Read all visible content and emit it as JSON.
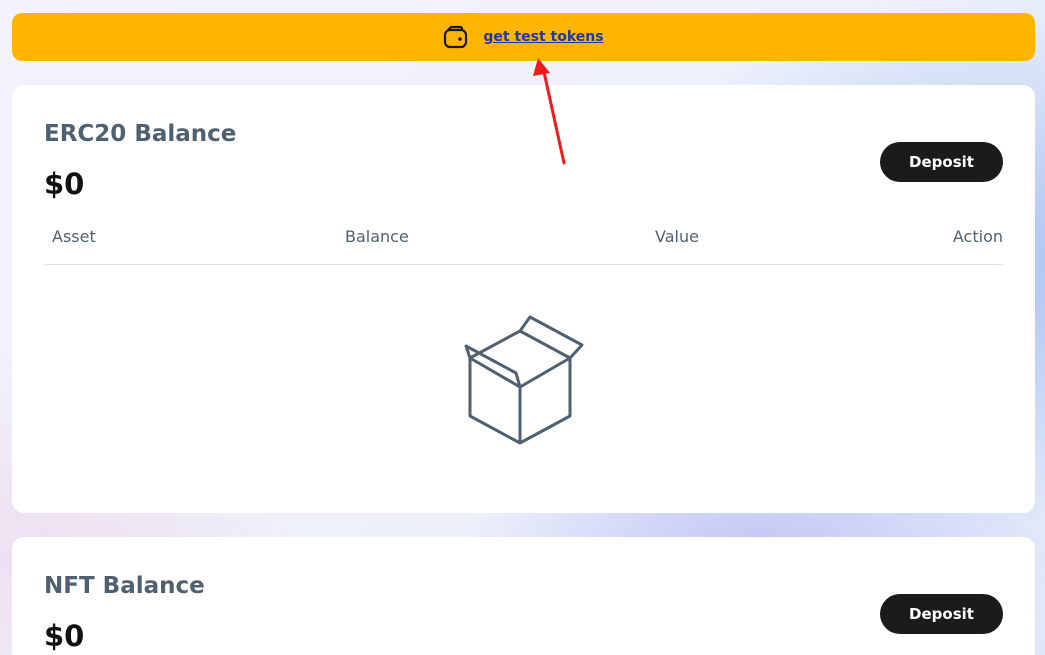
{
  "banner": {
    "link_text": "get test tokens",
    "icon": "wallet-icon",
    "background_color": "#ffb500"
  },
  "erc20": {
    "title": "ERC20 Balance",
    "amount": "$0",
    "deposit_label": "Deposit",
    "columns": [
      "Asset",
      "Balance",
      "Value",
      "Action"
    ],
    "empty_icon": "empty-box-icon"
  },
  "nft": {
    "title": "NFT Balance",
    "amount": "$0",
    "deposit_label": "Deposit"
  },
  "annotation": {
    "icon": "red-arrow-icon",
    "color": "#ee1c1c"
  }
}
